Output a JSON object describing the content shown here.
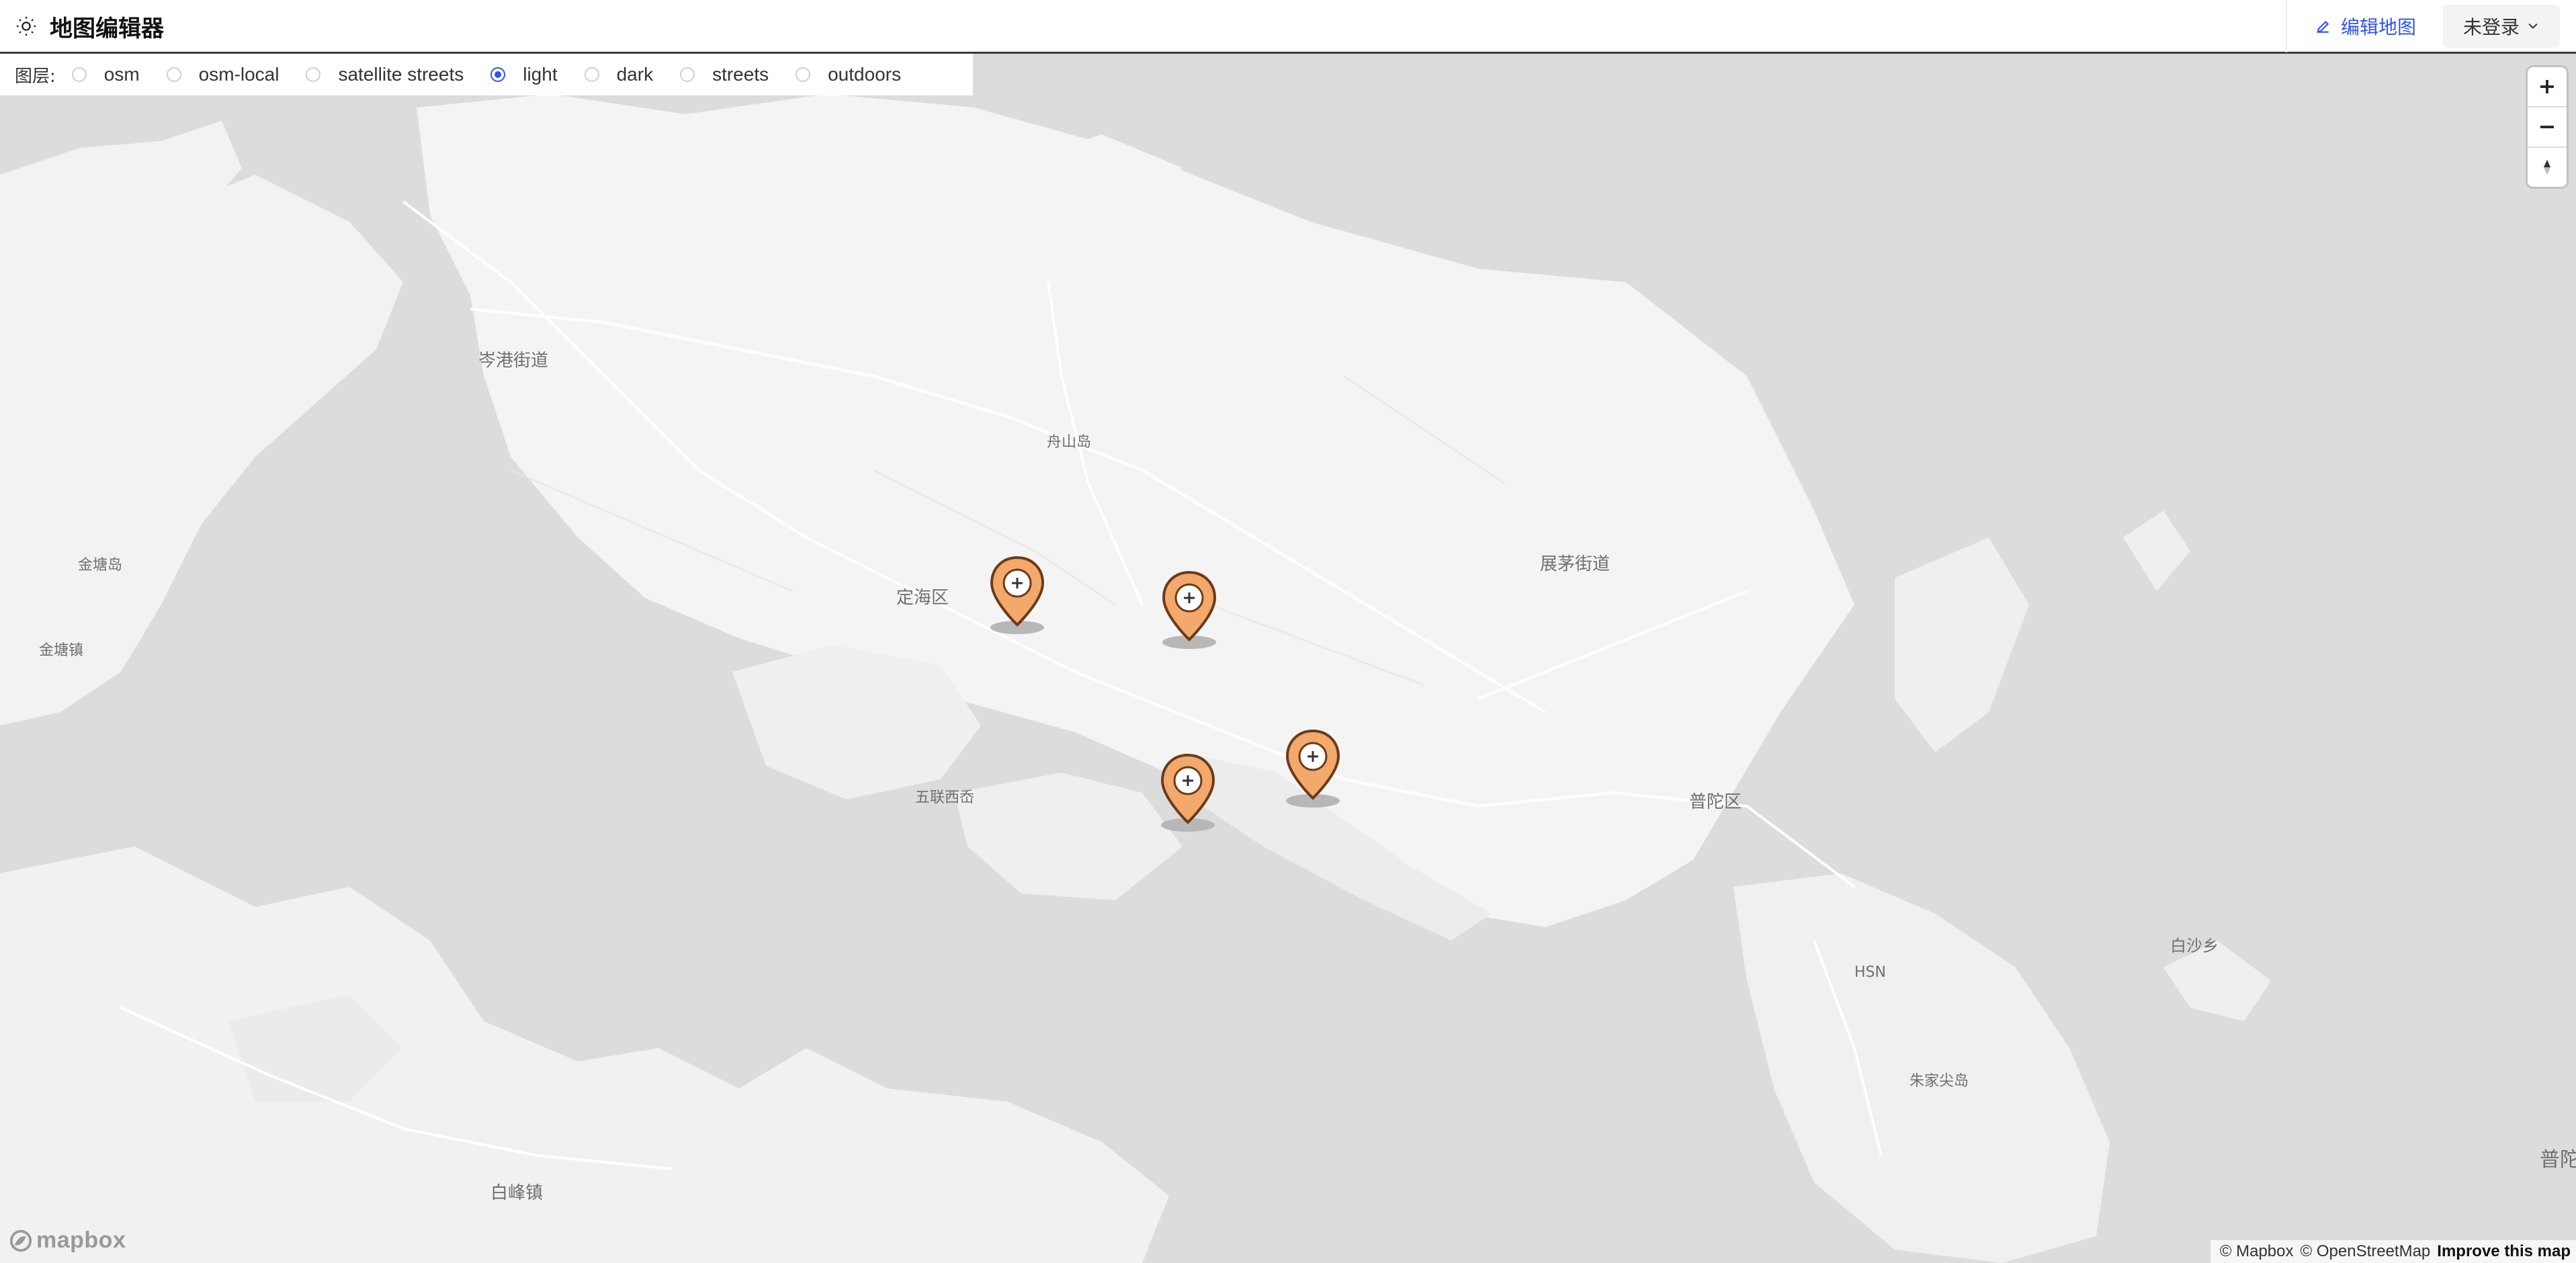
{
  "header": {
    "title": "地图编辑器",
    "edit_label": "编辑地图",
    "user_label": "未登录"
  },
  "layers": {
    "label": "图层:",
    "options": [
      "osm",
      "osm-local",
      "satellite streets",
      "light",
      "dark",
      "streets",
      "outdoors"
    ],
    "selected": "light"
  },
  "map": {
    "style": "light",
    "places": [
      {
        "name": "岑港街道"
      },
      {
        "name": "舟山岛"
      },
      {
        "name": "金塘岛"
      },
      {
        "name": "金塘镇"
      },
      {
        "name": "定海区"
      },
      {
        "name": "展茅街道"
      },
      {
        "name": "五联西岙"
      },
      {
        "name": "普陀区"
      },
      {
        "name": "HSN"
      },
      {
        "name": "白沙乡"
      },
      {
        "name": "朱家尖岛"
      },
      {
        "name": "白峰镇"
      },
      {
        "name": "普陀"
      }
    ],
    "marker_count": 4,
    "marker_color": "#f2a96b"
  },
  "controls": {
    "zoom_in": "zoom-in-icon",
    "zoom_out": "zoom-out-icon",
    "compass": "compass-icon"
  },
  "attribution": {
    "mapbox": "© Mapbox",
    "osm": "© OpenStreetMap",
    "improve": "Improve this map",
    "logo": "mapbox"
  }
}
